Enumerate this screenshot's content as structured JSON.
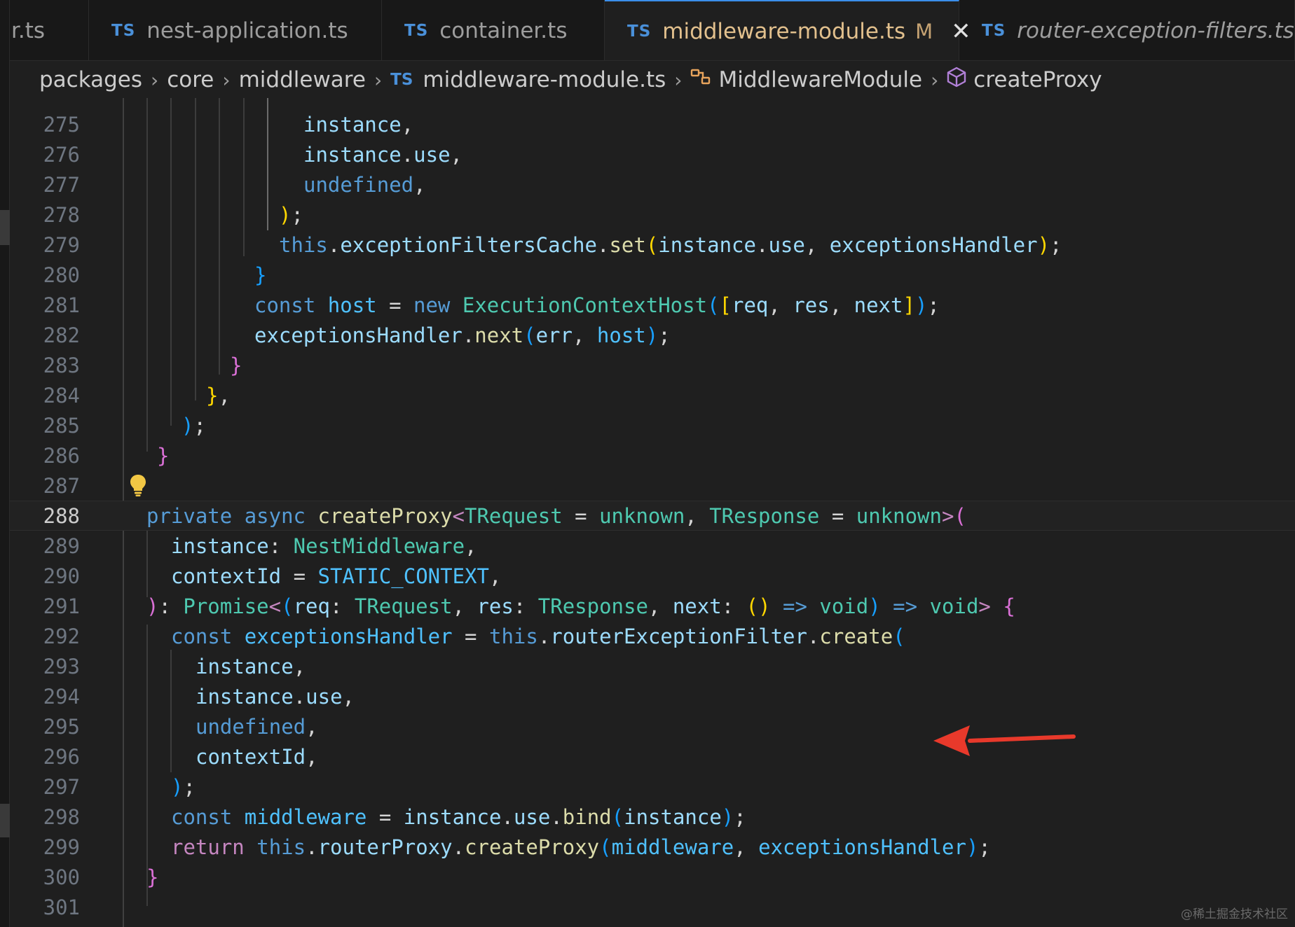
{
  "tabs": [
    {
      "label": "r.ts",
      "icon": "",
      "active": false
    },
    {
      "label": "nest-application.ts",
      "icon": "TS",
      "active": false
    },
    {
      "label": "container.ts",
      "icon": "TS",
      "active": false
    },
    {
      "label": "middleware-module.ts",
      "icon": "TS",
      "active": true,
      "modified": "M"
    },
    {
      "label": "router-exception-filters.ts",
      "icon": "TS",
      "active": false,
      "italic": true
    }
  ],
  "breadcrumbs": {
    "items": [
      "packages",
      "core",
      "middleware"
    ],
    "file_icon": "TS",
    "file": "middleware-module.ts",
    "class_name": "MiddlewareModule",
    "method_name": "createProxy"
  },
  "editor": {
    "active_line": "288",
    "line_numbers": [
      "275",
      "276",
      "277",
      "278",
      "279",
      "280",
      "281",
      "282",
      "283",
      "284",
      "285",
      "286",
      "287",
      "288",
      "289",
      "290",
      "291",
      "292",
      "293",
      "294",
      "295",
      "296",
      "297",
      "298",
      "299",
      "300",
      "301"
    ]
  },
  "watermark": "@稀土掘金技术社区",
  "colors": {
    "accent": "#3b8eea",
    "arrow": "#e8392b",
    "lightbulb": "#f2c744"
  }
}
